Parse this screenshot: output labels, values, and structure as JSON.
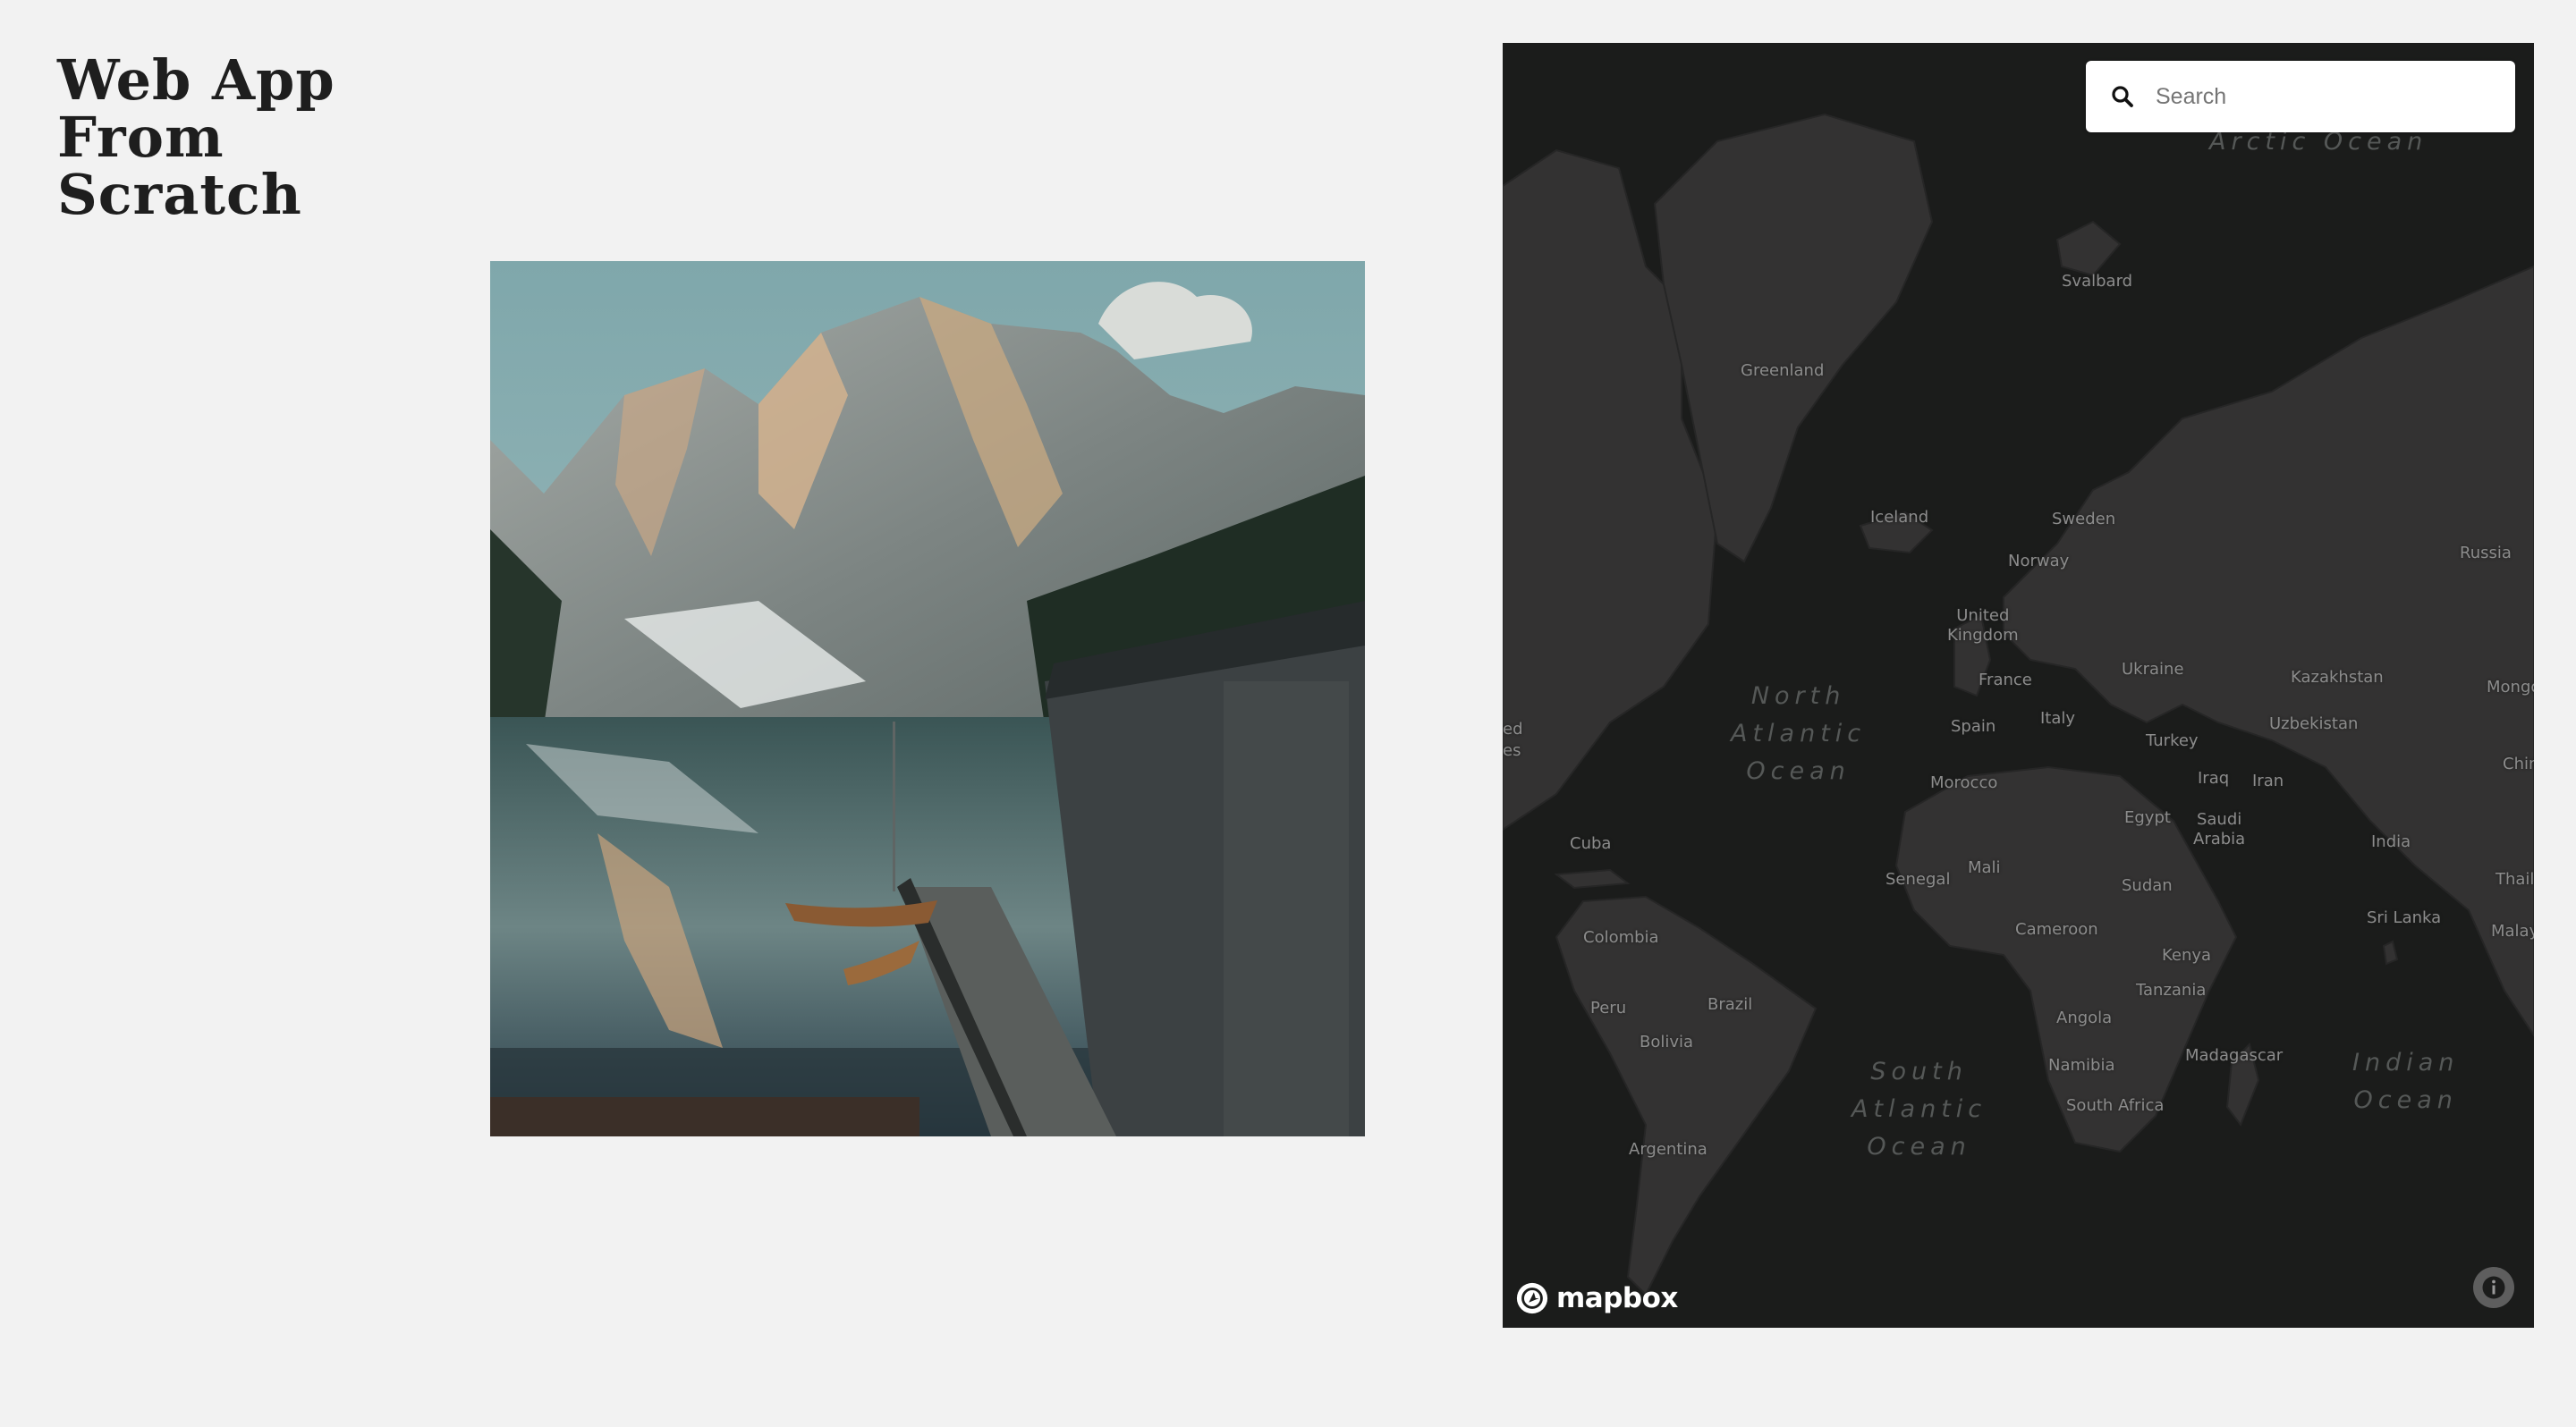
{
  "page": {
    "title_lines": [
      "Web App",
      "From",
      "Scratch"
    ]
  },
  "photo": {
    "subject": "mountain-lake-with-boathouse"
  },
  "map": {
    "search": {
      "placeholder": "Search",
      "value": ""
    },
    "attribution_logo": "mapbox",
    "labels": {
      "svalbard": "Svalbard",
      "greenland": "Greenland",
      "iceland": "Iceland",
      "sweden": "Sweden",
      "norway": "Norway",
      "russia": "Russia",
      "united_kingdom": "United\nKingdom",
      "france": "France",
      "ukraine": "Ukraine",
      "kazakhstan": "Kazakhstan",
      "mongolia": "Mongo",
      "spain": "Spain",
      "italy": "Italy",
      "uzbekistan": "Uzbekistan",
      "turkey": "Turkey",
      "china": "China",
      "morocco": "Morocco",
      "iraq": "Iraq",
      "iran": "Iran",
      "egypt": "Egypt",
      "saudi_arabia": "Saudi\nArabia",
      "india": "India",
      "cuba": "Cuba",
      "mali": "Mali",
      "senegal": "Senegal",
      "sudan": "Sudan",
      "thailand": "Thailan",
      "sri_lanka": "Sri Lanka",
      "cameroon": "Cameroon",
      "malaysia": "Malays",
      "colombia": "Colombia",
      "kenya": "Kenya",
      "tanzania": "Tanzania",
      "brazil": "Brazil",
      "peru": "Peru",
      "angola": "Angola",
      "bolivia": "Bolivia",
      "madagascar": "Madagascar",
      "namibia": "Namibia",
      "south_africa": "South Africa",
      "argentina": "Argentina",
      "united_states_partial": "ed\nes"
    },
    "oceans": {
      "arctic": "Arctic Ocean",
      "north_atlantic": "North\nAtlantic\nOcean",
      "south_atlantic": "South\nAtlantic\nOcean",
      "indian": "Indian\nOcean"
    }
  }
}
